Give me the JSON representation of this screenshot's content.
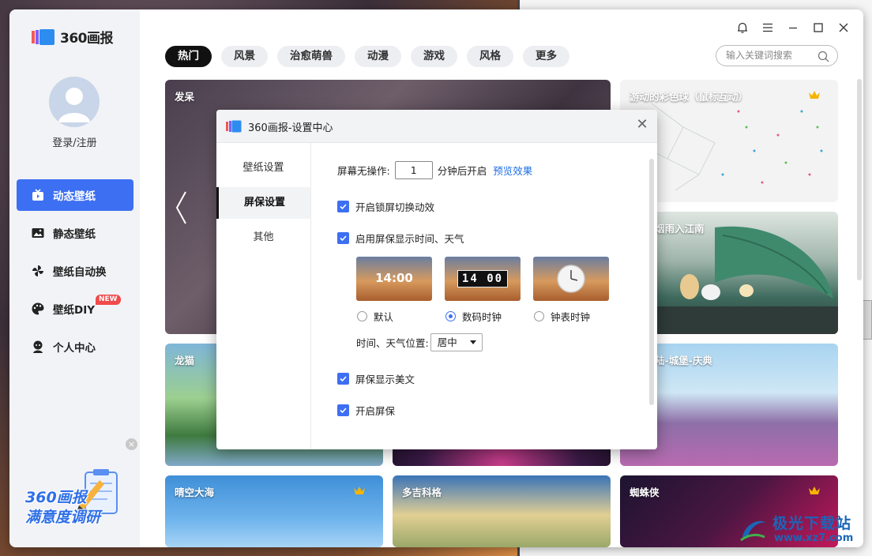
{
  "app": {
    "brand": "360画报",
    "login_label": "登录/注册",
    "nav": [
      {
        "label": "动态壁纸",
        "icon": "tv-icon",
        "active": true
      },
      {
        "label": "静态壁纸",
        "icon": "image-icon",
        "active": false
      },
      {
        "label": "壁纸自动换",
        "icon": "pinwheel-icon",
        "active": false
      },
      {
        "label": "壁纸DIY",
        "icon": "palette-icon",
        "active": false,
        "badge": "NEW"
      },
      {
        "label": "个人中心",
        "icon": "person-icon",
        "active": false
      }
    ],
    "survey": {
      "line1": "360画报",
      "line2": "满意度调研",
      "close": "×"
    }
  },
  "toolbar": {
    "tabs": [
      "热门",
      "风景",
      "治愈萌兽",
      "动漫",
      "游戏",
      "风格",
      "更多"
    ],
    "active_tab": "热门",
    "search_placeholder": "输入关键词搜索"
  },
  "cards": {
    "featured": "发呆",
    "right_top": "游动的彩色球（鼠标互动）",
    "right_mid": "烟雨入江南",
    "left_row2": "龙猫",
    "right_row2": "陆-城堡-庆典",
    "row3_a": "晴空大海",
    "row3_b": "多吉科格",
    "row3_c": "蜘蛛侠"
  },
  "dialog": {
    "title": "360画报-设置中心",
    "close": "✕",
    "side": [
      "壁纸设置",
      "屏保设置",
      "其他"
    ],
    "active_side": "屏保设置",
    "idle_label": "屏幕无操作:",
    "idle_value": "1",
    "idle_suffix": "分钟后开启",
    "preview_link": "预览效果",
    "option_lock_anim": "开启锁屏切换动效",
    "option_show_time": "启用屏保显示时间、天气",
    "clock_styles": [
      {
        "label": "默认",
        "preview_text": "14:00",
        "selected": false
      },
      {
        "label": "数码时钟",
        "preview_text": "14 00",
        "selected": true
      },
      {
        "label": "钟表时钟",
        "preview_text": "",
        "selected": false
      }
    ],
    "position_label": "时间、天气位置:",
    "position_value": "居中",
    "option_show_text": "屏保显示美文",
    "option_enable": "开启屏保"
  },
  "watermark": {
    "name": "极光下载站",
    "url": "www.xz7.com"
  },
  "colors": {
    "accent": "#3d6ff2",
    "link": "#1f6fe6",
    "badge": "#f14a4a"
  }
}
